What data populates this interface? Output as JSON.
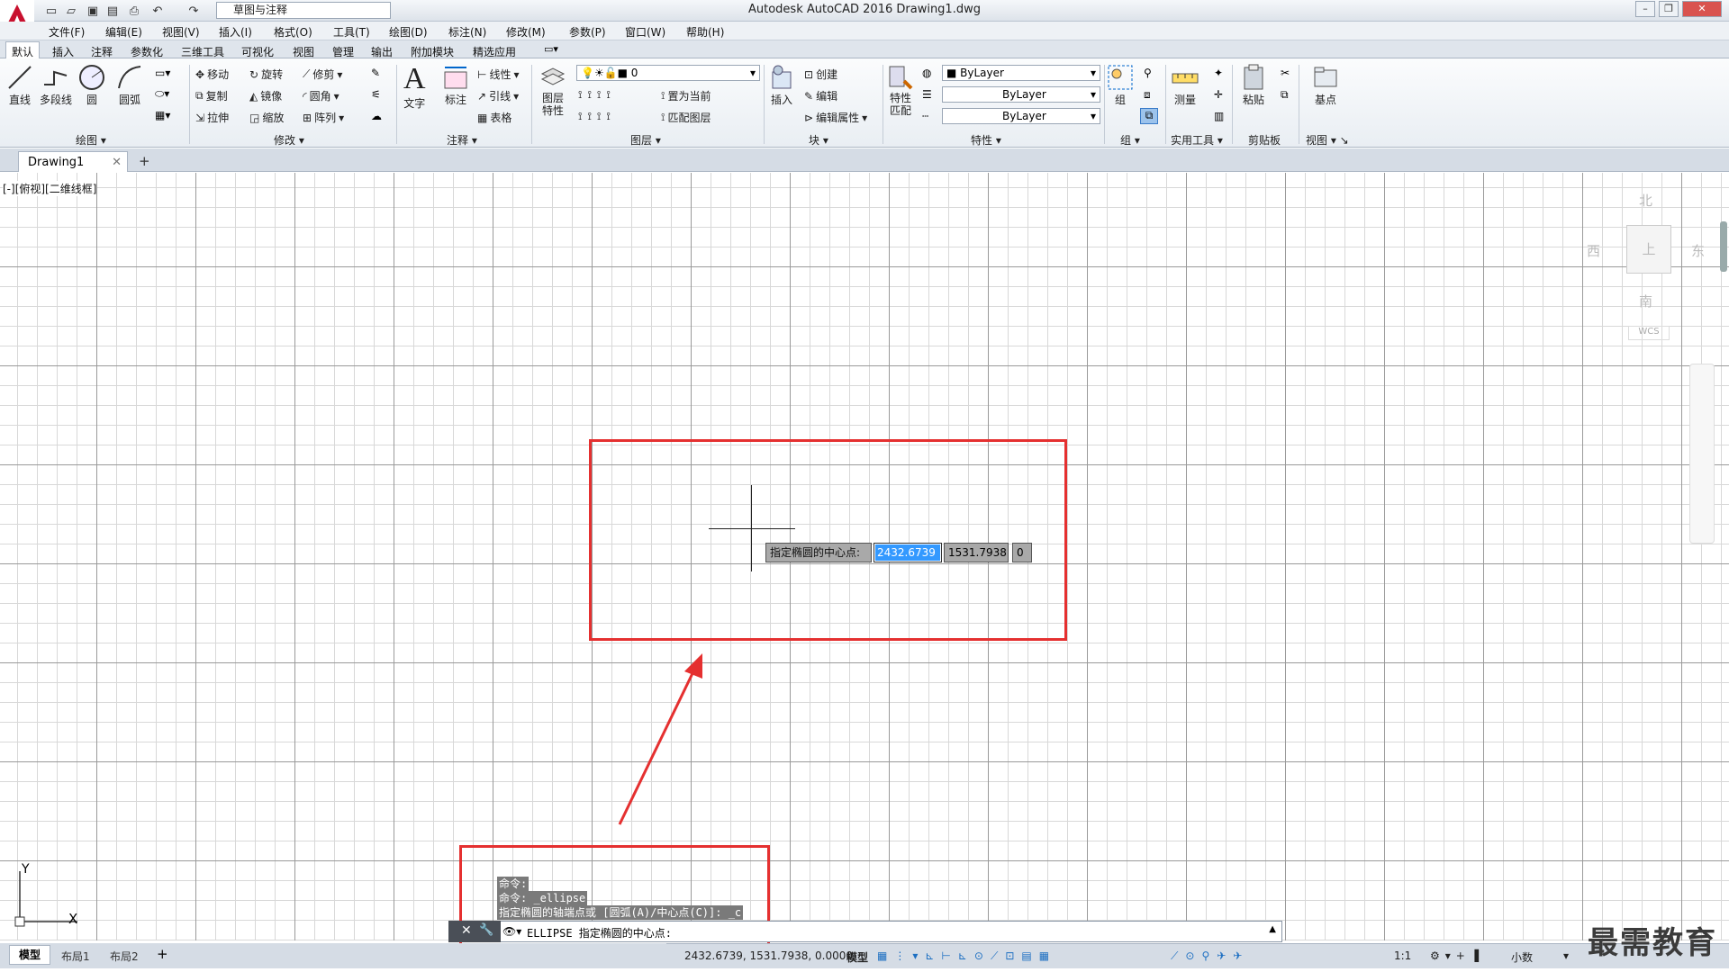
{
  "title_bar": {
    "title": "Autodesk AutoCAD 2016    Drawing1.dwg",
    "workspace": "草图与注释"
  },
  "menu": [
    "文件(F)",
    "编辑(E)",
    "视图(V)",
    "插入(I)",
    "格式(O)",
    "工具(T)",
    "绘图(D)",
    "标注(N)",
    "修改(M)",
    "参数(P)",
    "窗口(W)",
    "帮助(H)"
  ],
  "ribbon_tabs": [
    "默认",
    "插入",
    "注释",
    "参数化",
    "三维工具",
    "可视化",
    "视图",
    "管理",
    "输出",
    "附加模块",
    "精选应用"
  ],
  "ribbon": {
    "draw": {
      "title": "绘图",
      "line": "直线",
      "polyline": "多段线",
      "circle": "圆",
      "arc": "圆弧"
    },
    "modify": {
      "title": "修改",
      "move": "移动",
      "rotate": "旋转",
      "trim": "修剪",
      "copy": "复制",
      "mirror": "镜像",
      "fillet": "圆角",
      "stretch": "拉伸",
      "scale": "缩放",
      "array": "阵列"
    },
    "annotation": {
      "title": "注释",
      "text": "文字",
      "dimension": "标注",
      "linear": "线性",
      "leader": "引线",
      "table": "表格"
    },
    "layers": {
      "title": "图层",
      "layer_props": "图层特性",
      "current_layer": "0",
      "set_current": "置为当前",
      "match_layer": "匹配图层"
    },
    "block": {
      "title": "块",
      "insert": "插入",
      "create": "创建",
      "edit": "编辑",
      "edit_attr": "编辑属性"
    },
    "properties": {
      "title": "特性",
      "match": "特性匹配",
      "color": "ByLayer",
      "linetype": "ByLayer",
      "lineweight": "ByLayer"
    },
    "groups": {
      "title": "组",
      "group": "组"
    },
    "utilities": {
      "title": "实用工具",
      "measure": "测量"
    },
    "clipboard": {
      "title": "剪贴板",
      "paste": "粘贴"
    },
    "view": {
      "title": "视图",
      "base": "基点"
    }
  },
  "doc_tab": "Drawing1",
  "viewport_label": "[-][俯视][二维线框]",
  "viewcube": {
    "north": "北",
    "south": "南",
    "east": "东",
    "west": "西",
    "top": "上",
    "wcs": "WCS"
  },
  "dynamic_input": {
    "prompt": "指定椭圆的中心点:",
    "x": "2432.6739",
    "y": "1531.7938",
    "z": "0"
  },
  "command_history": [
    "命令:",
    "命令: _ellipse",
    "指定椭圆的轴端点或 [圆弧(A)/中心点(C)]: _c"
  ],
  "command_line": "ELLIPSE 指定椭圆的中心点:",
  "layout_tabs": [
    "模型",
    "布局1",
    "布局2"
  ],
  "status": {
    "coords": "2432.6739, 1531.7938, 0.0000",
    "model": "模型",
    "scale": "1:1",
    "units": "小数"
  },
  "ucs": {
    "x": "X",
    "y": "Y"
  },
  "watermark": "最需教育",
  "colors": {
    "highlight_red": "#e53030",
    "selected_value": "#3399ff",
    "dyn_bg": "#a9a9a9"
  }
}
